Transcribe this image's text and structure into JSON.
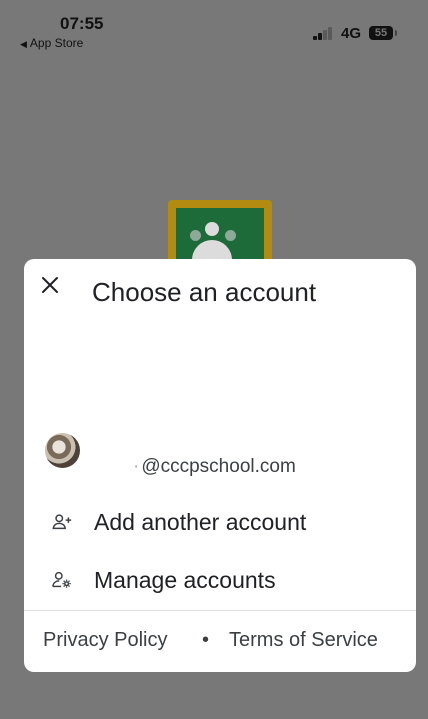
{
  "status_bar": {
    "time": "07:55",
    "back_label": "App Store",
    "network": "4G",
    "battery": "55"
  },
  "dialog": {
    "close_icon": "close-icon",
    "title": "Choose an account",
    "account": {
      "email": "@cccpschool.com"
    },
    "add_account": {
      "icon": "person-add-icon",
      "label": "Add another account"
    },
    "manage_accounts": {
      "icon": "manage-accounts-icon",
      "label": "Manage accounts"
    },
    "footer": {
      "privacy": "Privacy Policy",
      "separator": "•",
      "terms": "Terms of Service"
    }
  },
  "colors": {
    "backdrop": "#787878",
    "dialog_bg": "#ffffff",
    "text_primary": "#202124",
    "logo_frame": "#b38b10",
    "logo_board": "#1e6b3a"
  }
}
